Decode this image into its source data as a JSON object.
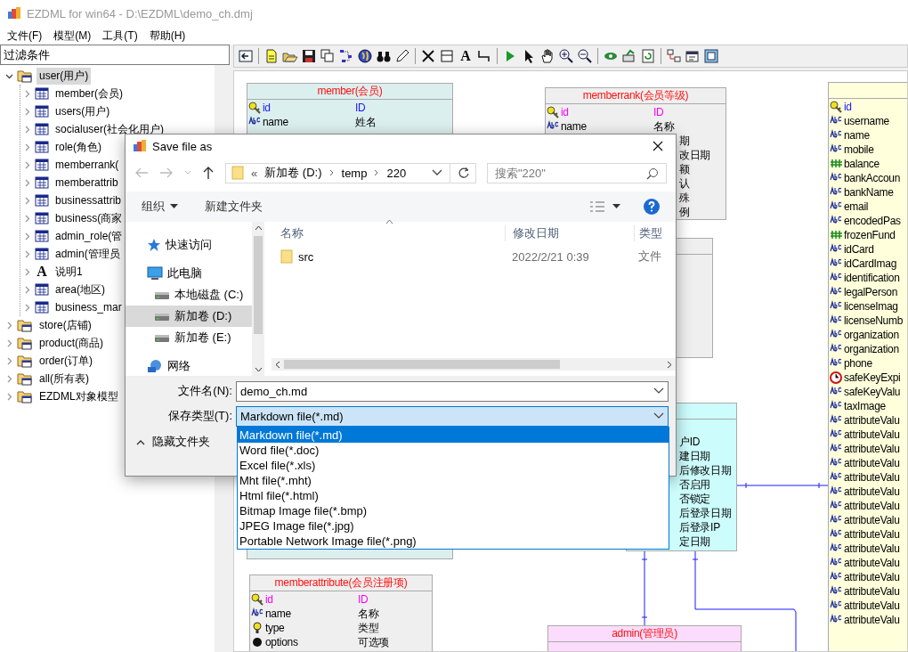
{
  "window": {
    "title": "EZDML for win64 - D:\\EZDML\\demo_ch.dmj"
  },
  "menu": [
    "文件(F)",
    "模型(M)",
    "工具(T)",
    "帮助(H)"
  ],
  "filter": {
    "value": "过滤条件"
  },
  "tree": [
    {
      "label": "user(用户)",
      "kind": "folder",
      "expanded": true,
      "selected": true,
      "children": [
        {
          "label": "member(会员)",
          "kind": "table",
          "expanded": false,
          "selected": false
        },
        {
          "label": "users(用户)",
          "kind": "table",
          "expanded": false,
          "selected": false
        },
        {
          "label": "socialuser(社会化用户)",
          "kind": "table",
          "expanded": false,
          "selected": false
        },
        {
          "label": "role(角色)",
          "kind": "table",
          "expanded": false,
          "selected": false
        },
        {
          "label": "memberrank(",
          "kind": "table",
          "expanded": false,
          "selected": false
        },
        {
          "label": "memberattrib",
          "kind": "table",
          "expanded": false,
          "selected": false
        },
        {
          "label": "businessattrib",
          "kind": "table",
          "expanded": false,
          "selected": false
        },
        {
          "label": "business(商家",
          "kind": "table",
          "expanded": false,
          "selected": false
        },
        {
          "label": "admin_role(管",
          "kind": "table",
          "expanded": false,
          "selected": false
        },
        {
          "label": "admin(管理员",
          "kind": "table",
          "expanded": false,
          "selected": false
        },
        {
          "label": "说明1",
          "kind": "text",
          "icon_char": "A",
          "expanded": false,
          "selected": false
        },
        {
          "label": "area(地区)",
          "kind": "table",
          "expanded": false,
          "selected": false
        },
        {
          "label": "business_mar",
          "kind": "table",
          "expanded": false,
          "selected": false
        }
      ]
    },
    {
      "label": "store(店铺)",
      "kind": "folder",
      "expanded": false,
      "selected": false
    },
    {
      "label": "product(商品)",
      "kind": "folder",
      "expanded": false,
      "selected": false
    },
    {
      "label": "order(订单)",
      "kind": "folder",
      "expanded": false,
      "selected": false
    },
    {
      "label": "all(所有表)",
      "kind": "folder",
      "expanded": false,
      "selected": false
    },
    {
      "label": "EZDML对象模型",
      "kind": "folder",
      "expanded": false,
      "selected": false
    }
  ],
  "toolbar": [
    {
      "kind": "exit"
    },
    {
      "kind": "sep"
    },
    {
      "kind": "new"
    },
    {
      "kind": "open"
    },
    {
      "kind": "save"
    },
    {
      "kind": "copy"
    },
    {
      "kind": "layout"
    },
    {
      "kind": "globe"
    },
    {
      "kind": "find"
    },
    {
      "kind": "edit"
    },
    {
      "kind": "sep"
    },
    {
      "kind": "delete"
    },
    {
      "kind": "table"
    },
    {
      "kind": "text",
      "label": "A"
    },
    {
      "kind": "link"
    },
    {
      "kind": "sep"
    },
    {
      "kind": "run"
    },
    {
      "kind": "pointer"
    },
    {
      "kind": "hand"
    },
    {
      "kind": "zoom-in"
    },
    {
      "kind": "zoom-out"
    },
    {
      "kind": "sep"
    },
    {
      "kind": "eye"
    },
    {
      "kind": "export"
    },
    {
      "kind": "refresh"
    },
    {
      "kind": "sep"
    },
    {
      "kind": "import"
    },
    {
      "kind": "settings"
    },
    {
      "kind": "fullscreen"
    }
  ],
  "entities": [
    {
      "title": "member(会员)",
      "kind": "teal",
      "fields": [
        {
          "name": "id",
          "comment": "ID",
          "kind": "key"
        },
        {
          "name": "name",
          "comment": "姓名",
          "kind": "text"
        }
      ]
    },
    {
      "title": "memberrank(会员等级)",
      "kind": "grey",
      "fields": [
        {
          "name": "id",
          "comment": "ID",
          "kind": "key"
        },
        {
          "name": "name",
          "comment": "名称",
          "kind": "text"
        },
        {
          "comment": "期"
        },
        {
          "comment": "改日期"
        },
        {
          "comment": "额"
        },
        {
          "comment": "认"
        },
        {
          "comment": "殊"
        },
        {
          "comment": "例"
        }
      ]
    },
    {
      "kind": "grey"
    },
    {
      "kind": "cyan",
      "fields": [
        {
          "comment": "户ID"
        },
        {
          "comment": "建日期"
        },
        {
          "comment": "后修改日期"
        },
        {
          "comment": "否启用"
        },
        {
          "comment": "否锁定"
        },
        {
          "comment": "后登录日期"
        },
        {
          "comment": "后登录IP"
        },
        {
          "comment": "定日期"
        }
      ]
    },
    {
      "kind": "yellow",
      "fields": [
        {
          "name": "id",
          "kind": "key"
        },
        {
          "name": "username",
          "kind": "text"
        },
        {
          "name": "name",
          "kind": "text"
        },
        {
          "name": "mobile",
          "kind": "text"
        },
        {
          "name": "balance",
          "kind": "number"
        },
        {
          "name": "bankAccoun",
          "kind": "text"
        },
        {
          "name": "bankName",
          "kind": "text"
        },
        {
          "name": "email",
          "kind": "text"
        },
        {
          "name": "encodedPas",
          "kind": "text"
        },
        {
          "name": "frozenFund",
          "kind": "number"
        },
        {
          "name": "idCard",
          "kind": "text"
        },
        {
          "name": "idCardImag",
          "kind": "text"
        },
        {
          "name": "identification",
          "kind": "text"
        },
        {
          "name": "legalPerson",
          "kind": "text"
        },
        {
          "name": "licenseImag",
          "kind": "text"
        },
        {
          "name": "licenseNumb",
          "kind": "text"
        },
        {
          "name": "organization",
          "kind": "text"
        },
        {
          "name": "organization",
          "kind": "text"
        },
        {
          "name": "phone",
          "kind": "text"
        },
        {
          "name": "safeKeyExpi",
          "kind": "date"
        },
        {
          "name": "safeKeyValu",
          "kind": "text"
        },
        {
          "name": "taxImage",
          "kind": "text"
        },
        {
          "name": "attributeValu",
          "kind": "text"
        },
        {
          "name": "attributeValu",
          "kind": "text"
        },
        {
          "name": "attributeValu",
          "kind": "text"
        },
        {
          "name": "attributeValu",
          "kind": "text"
        },
        {
          "name": "attributeValu",
          "kind": "text"
        },
        {
          "name": "attributeValu",
          "kind": "text"
        },
        {
          "name": "attributeValu",
          "kind": "text"
        },
        {
          "name": "attributeValu",
          "kind": "text"
        },
        {
          "name": "attributeValu",
          "kind": "text"
        },
        {
          "name": "attributeValu",
          "kind": "text"
        },
        {
          "name": "attributeValu",
          "kind": "text"
        },
        {
          "name": "attributeValu",
          "kind": "text"
        },
        {
          "name": "attributeValu",
          "kind": "text"
        },
        {
          "name": "attributeValu",
          "kind": "text"
        },
        {
          "name": "attributeValu",
          "kind": "text"
        }
      ]
    },
    {
      "title": "memberattribute(会员注册项)",
      "kind": "grey",
      "fields": [
        {
          "name": "id",
          "comment": "ID",
          "kind": "key"
        },
        {
          "name": "name",
          "comment": "名称",
          "kind": "text"
        },
        {
          "name": "type",
          "comment": "类型",
          "kind": "enum"
        },
        {
          "name": "options",
          "comment": "可选项",
          "kind": "list"
        }
      ]
    },
    {
      "title": "admin(管理员)",
      "kind": "pink"
    }
  ],
  "dialog": {
    "title": "Save file as",
    "path": [
      "新加卷 (D:)",
      "temp",
      "220"
    ],
    "path_prefix": "«",
    "search": {
      "placeholder": "搜索\"220\""
    },
    "organize": "组织",
    "new_folder": "新建文件夹",
    "nav": [
      {
        "label": "快速访问",
        "kind": "star",
        "selected": false
      },
      {
        "label": "此电脑",
        "kind": "pc",
        "selected": false
      },
      {
        "label": "本地磁盘 (C:)",
        "kind": "drive",
        "selected": false
      },
      {
        "label": "新加卷 (D:)",
        "kind": "drive",
        "selected": true
      },
      {
        "label": "新加卷 (E:)",
        "kind": "drive",
        "selected": false
      },
      {
        "label": "网络",
        "kind": "network",
        "selected": false
      }
    ],
    "columns": [
      "名称",
      "修改日期",
      "类型"
    ],
    "files": [
      {
        "name": "src",
        "date": "2022/2/21 0:39",
        "type": "文件"
      }
    ],
    "filename_label": "文件名(N):",
    "filename": "demo_ch.md",
    "filetype_label": "保存类型(T):",
    "filetype": "Markdown file(*.md)",
    "hide_folders": "隐藏文件夹",
    "filetype_options": [
      {
        "label": "Markdown file(*.md)",
        "selected": true
      },
      {
        "label": "Word file(*.doc)",
        "selected": false
      },
      {
        "label": "Excel file(*.xls)",
        "selected": false
      },
      {
        "label": "Mht file(*.mht)",
        "selected": false
      },
      {
        "label": "Html file(*.html)",
        "selected": false
      },
      {
        "label": "Bitmap Image file(*.bmp)",
        "selected": false
      },
      {
        "label": "JPEG Image file(*.jpg)",
        "selected": false
      },
      {
        "label": "Portable Network Image file(*.png)",
        "selected": false
      }
    ]
  }
}
